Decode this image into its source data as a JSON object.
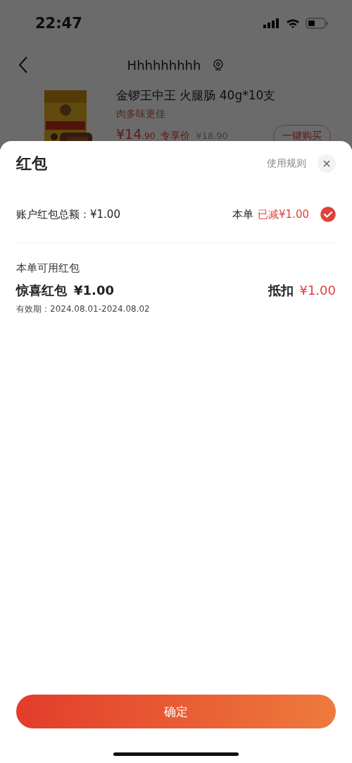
{
  "status_bar": {
    "time": "22:47"
  },
  "nav": {
    "title": "Hhhhhhhhh"
  },
  "product": {
    "kind": "picture",
    "name": "金锣王中王 火腿肠 40g*10支",
    "slogan": "肉多味更佳",
    "price_integer": "¥14",
    "price_decimal": ".90",
    "price_tag": "专享价",
    "original_price": "¥18.90",
    "buy_button": "一键购买"
  },
  "sheet": {
    "title": "红包",
    "rules_link": "使用规则",
    "summary": {
      "label": "账户红包总额：¥1.00",
      "order_label": "本单",
      "deducted": "已减¥1.00",
      "selected": true
    },
    "section_title": "本单可用红包",
    "coupons": [
      {
        "name": "惊喜红包",
        "amount": "¥1.00",
        "validity": "有效期：2024.08.01-2024.08.02",
        "deduct_label": "抵扣",
        "deduct_amount": "¥1.00"
      }
    ],
    "confirm_button": "确定"
  }
}
